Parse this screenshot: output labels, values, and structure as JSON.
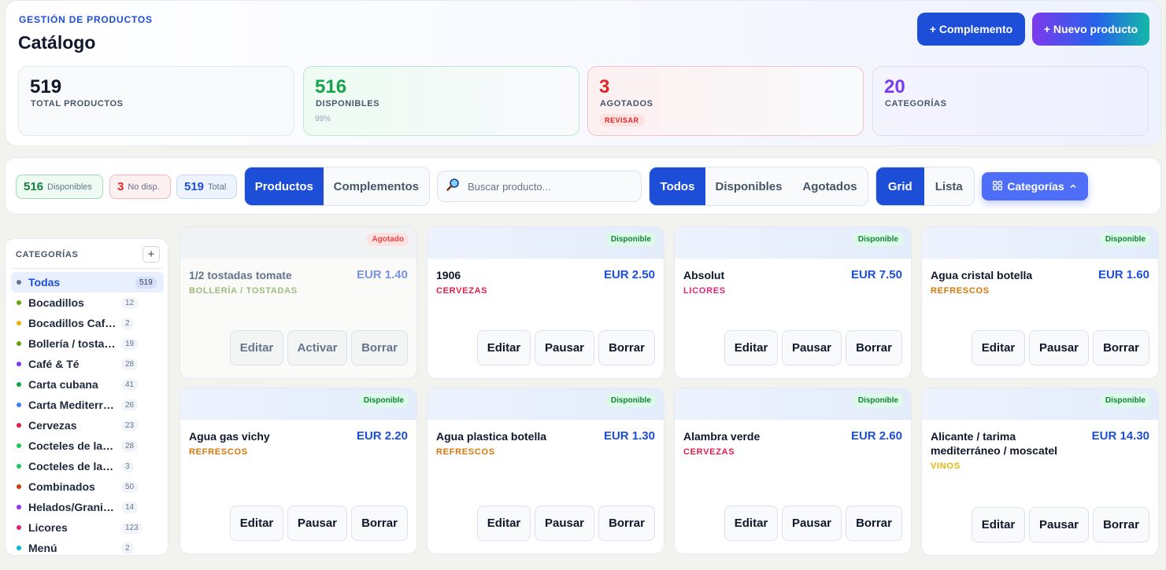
{
  "header": {
    "eyebrow": "GESTIÓN DE PRODUCTOS",
    "title": "Catálogo",
    "btn_complemento": "+ Complemento",
    "btn_nuevo": "+ Nuevo producto"
  },
  "stats": {
    "total": {
      "value": "519",
      "label": "TOTAL PRODUCTOS"
    },
    "disponibles": {
      "value": "516",
      "label": "DISPONIBLES",
      "sub": "99%"
    },
    "agotados": {
      "value": "3",
      "label": "AGOTADOS",
      "badge": "REVISAR"
    },
    "categorias": {
      "value": "20",
      "label": "CATEGORÍAS"
    }
  },
  "toolbar": {
    "pills": [
      {
        "n": "516",
        "t": "Disponibles"
      },
      {
        "n": "3",
        "t": "No disp."
      },
      {
        "n": "519",
        "t": "Total"
      }
    ],
    "type_tabs": [
      "Productos",
      "Complementos"
    ],
    "search_placeholder": "Buscar producto...",
    "status_tabs": [
      "Todos",
      "Disponibles",
      "Agotados"
    ],
    "view_tabs": [
      "Grid",
      "Lista"
    ],
    "categories_button": "Categorías"
  },
  "sidebar": {
    "heading": "CATEGORÍAS",
    "add": "+",
    "items": [
      {
        "name": "Todas",
        "count": "519",
        "color": "#64748b"
      },
      {
        "name": "Bocadillos",
        "count": "12",
        "color": "#65a30d"
      },
      {
        "name": "Bocadillos Cafetería",
        "count": "2",
        "color": "#eab308"
      },
      {
        "name": "Bollería / tostadas",
        "count": "19",
        "color": "#65a30d"
      },
      {
        "name": "Café & Té",
        "count": "28",
        "color": "#7c3aed"
      },
      {
        "name": "Carta cubana",
        "count": "41",
        "color": "#16a34a"
      },
      {
        "name": "Carta Mediterránea",
        "count": "26",
        "color": "#3b82f6"
      },
      {
        "name": "Cervezas",
        "count": "23",
        "color": "#e11d48"
      },
      {
        "name": "Cocteles de la casa",
        "count": "28",
        "color": "#22c55e"
      },
      {
        "name": "Cocteles de la carta",
        "count": "3",
        "color": "#22c55e"
      },
      {
        "name": "Combinados",
        "count": "50",
        "color": "#c2410c"
      },
      {
        "name": "Helados/Granizados",
        "count": "14",
        "color": "#9333ea"
      },
      {
        "name": "Licores",
        "count": "123",
        "color": "#db2777"
      },
      {
        "name": "Menú",
        "count": "2",
        "color": "#06b6d4"
      }
    ]
  },
  "products": [
    {
      "name": "1/2 tostadas tomate",
      "price": "EUR 1.40",
      "category": "BOLLERÍA / TOSTADAS",
      "cat_color": "#9bbc7a",
      "status": "Agotado",
      "actions": [
        "Editar",
        "Activar",
        "Borrar"
      ]
    },
    {
      "name": "1906",
      "price": "EUR 2.50",
      "category": "CERVEZAS",
      "cat_color": "#e11d48",
      "status": "Disponible",
      "actions": [
        "Editar",
        "Pausar",
        "Borrar"
      ]
    },
    {
      "name": "Absolut",
      "price": "EUR 7.50",
      "category": "LICORES",
      "cat_color": "#db2777",
      "status": "Disponible",
      "actions": [
        "Editar",
        "Pausar",
        "Borrar"
      ]
    },
    {
      "name": "Agua cristal botella",
      "price": "EUR 1.60",
      "category": "REFRESCOS",
      "cat_color": "#d97706",
      "status": "Disponible",
      "actions": [
        "Editar",
        "Pausar",
        "Borrar"
      ]
    },
    {
      "name": "Agua gas vichy",
      "price": "EUR 2.20",
      "category": "REFRESCOS",
      "cat_color": "#d97706",
      "status": "Disponible",
      "actions": [
        "Editar",
        "Pausar",
        "Borrar"
      ]
    },
    {
      "name": "Agua plastica botella",
      "price": "EUR 1.30",
      "category": "REFRESCOS",
      "cat_color": "#d97706",
      "status": "Disponible",
      "actions": [
        "Editar",
        "Pausar",
        "Borrar"
      ]
    },
    {
      "name": "Alambra verde",
      "price": "EUR 2.60",
      "category": "CERVEZAS",
      "cat_color": "#e11d48",
      "status": "Disponible",
      "actions": [
        "Editar",
        "Pausar",
        "Borrar"
      ]
    },
    {
      "name": "Alicante / tarima mediterráneo / moscatel",
      "price": "EUR 14.30",
      "category": "VINOS",
      "cat_color": "#eab308",
      "status": "Disponible",
      "actions": [
        "Editar",
        "Pausar",
        "Borrar"
      ]
    }
  ]
}
